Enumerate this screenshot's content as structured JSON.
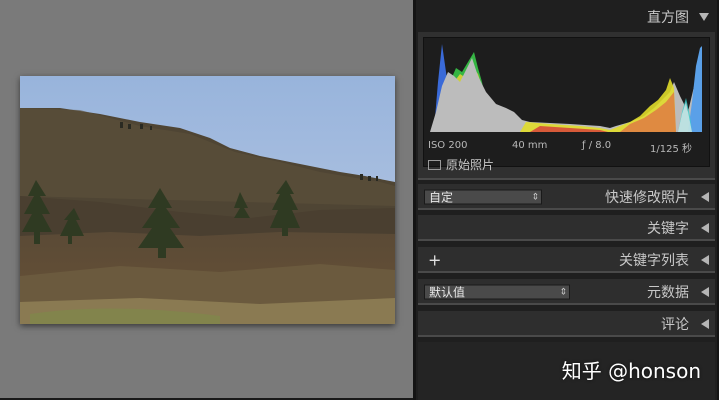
{
  "histogram": {
    "title": "直方图",
    "iso": "ISO 200",
    "focal_length": "40 mm",
    "aperture": "ƒ / 8.0",
    "shutter": "1/125 秒",
    "original_photo_label": "原始照片"
  },
  "quick_develop": {
    "title": "快速修改照片",
    "preset_value": "自定"
  },
  "keywords": {
    "title": "关键字"
  },
  "keyword_list": {
    "title": "关键字列表",
    "add_symbol": "+"
  },
  "metadata": {
    "title": "元数据",
    "preset_value": "默认值"
  },
  "comments": {
    "title": "评论"
  },
  "watermark": "知乎 @honson",
  "colors": {
    "preview_bg": "#7a7a7a",
    "panel_bg": "#2e2e2e",
    "text": "#c8c8c8"
  }
}
